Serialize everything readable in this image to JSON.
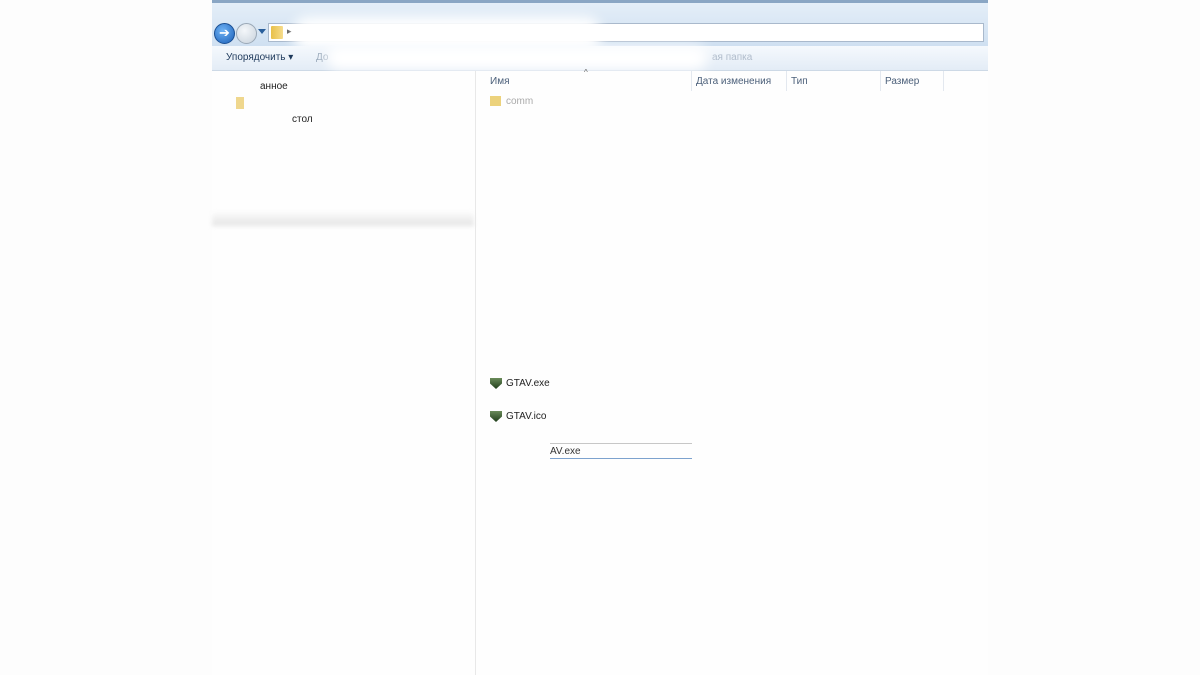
{
  "toolbar": {
    "organize_label": "Упорядочить ▾",
    "add_label_partial": "До",
    "new_folder_partial": "ая папка"
  },
  "nav_pane": {
    "items": [
      {
        "label": "анное"
      },
      {
        "label": "стол"
      }
    ]
  },
  "columns": [
    {
      "label": "Имя"
    },
    {
      "label": "Дата изменения"
    },
    {
      "label": "Тип"
    },
    {
      "label": "Размер"
    }
  ],
  "files": [
    {
      "name": "comm",
      "icon": "folder-icon"
    },
    {
      "name": "GTAV.exe",
      "icon": "gta-v-icon"
    },
    {
      "name": "GTAV.ico",
      "icon": "gta-v-icon"
    }
  ],
  "rename_field": {
    "value": "AV.exe"
  }
}
